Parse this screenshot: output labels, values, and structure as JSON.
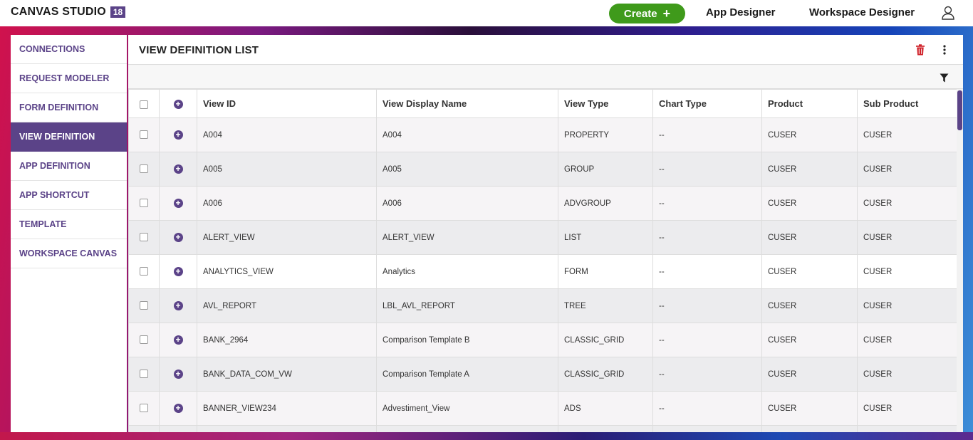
{
  "app": {
    "title": "CANVAS STUDIO",
    "version_badge": "18"
  },
  "header": {
    "create_label": "Create",
    "create_icon": "plus-icon",
    "nav": [
      "App Designer",
      "Workspace Designer"
    ],
    "user_icon": "user-icon"
  },
  "sidebar": {
    "items": [
      {
        "label": "CONNECTIONS",
        "active": false
      },
      {
        "label": "REQUEST MODELER",
        "active": false
      },
      {
        "label": "FORM DEFINITION",
        "active": false
      },
      {
        "label": "VIEW DEFINITION",
        "active": true
      },
      {
        "label": "APP DEFINITION",
        "active": false
      },
      {
        "label": "APP SHORTCUT",
        "active": false
      },
      {
        "label": "TEMPLATE",
        "active": false
      },
      {
        "label": "WORKSPACE CANVAS",
        "active": false
      }
    ]
  },
  "main": {
    "title": "VIEW DEFINITION LIST",
    "icons": [
      "trash-icon",
      "more-vertical-icon",
      "filter-icon"
    ],
    "columns": [
      "View ID",
      "View Display Name",
      "View Type",
      "Chart Type",
      "Product",
      "Sub Product"
    ],
    "rows": [
      [
        "A004",
        "A004",
        "PROPERTY",
        "--",
        "CUSER",
        "CUSER"
      ],
      [
        "A005",
        "A005",
        "GROUP",
        "--",
        "CUSER",
        "CUSER"
      ],
      [
        "A006",
        "A006",
        "ADVGROUP",
        "--",
        "CUSER",
        "CUSER"
      ],
      [
        "ALERT_VIEW",
        "ALERT_VIEW",
        "LIST",
        "--",
        "CUSER",
        "CUSER"
      ],
      [
        "ANALYTICS_VIEW",
        "Analytics",
        "FORM",
        "--",
        "CUSER",
        "CUSER"
      ],
      [
        "AVL_REPORT",
        "LBL_AVL_REPORT",
        "TREE",
        "--",
        "CUSER",
        "CUSER"
      ],
      [
        "BANK_2964",
        "Comparison Template B",
        "CLASSIC_GRID",
        "--",
        "CUSER",
        "CUSER"
      ],
      [
        "BANK_DATA_COM_VW",
        "Comparison Template A",
        "CLASSIC_GRID",
        "--",
        "CUSER",
        "CUSER"
      ],
      [
        "BANNER_VIEW234",
        "Advestiment_View",
        "ADS",
        "--",
        "CUSER",
        "CUSER"
      ]
    ]
  },
  "colors": {
    "accent": "#5b4388",
    "create": "#3f9a1b",
    "delete": "#d0222a"
  }
}
